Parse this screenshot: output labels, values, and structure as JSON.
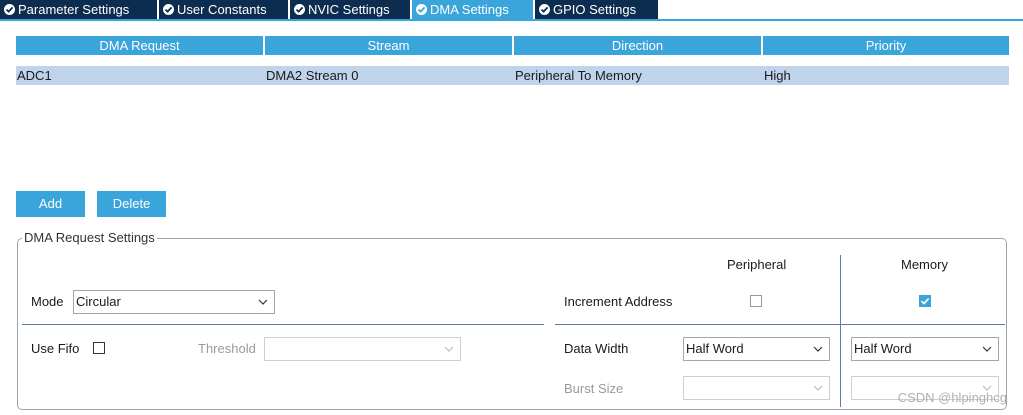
{
  "tabs": [
    {
      "label": "Parameter Settings",
      "active": false
    },
    {
      "label": "User Constants",
      "active": false
    },
    {
      "label": "NVIC Settings",
      "active": false
    },
    {
      "label": "DMA Settings",
      "active": true
    },
    {
      "label": "GPIO Settings",
      "active": false
    }
  ],
  "table": {
    "headers": [
      "DMA Request",
      "Stream",
      "Direction",
      "Priority"
    ],
    "rows": [
      [
        "ADC1",
        "DMA2 Stream 0",
        "Peripheral To Memory",
        "High"
      ]
    ]
  },
  "buttons": {
    "add": "Add",
    "delete": "Delete"
  },
  "settings": {
    "title": "DMA Request Settings",
    "peripheral_label": "Peripheral",
    "memory_label": "Memory",
    "mode_label": "Mode",
    "mode_value": "Circular",
    "increment_label": "Increment Address",
    "increment_peripheral_checked": false,
    "increment_memory_checked": true,
    "use_fifo_label": "Use Fifo",
    "use_fifo_checked": false,
    "threshold_label": "Threshold",
    "threshold_value": "",
    "data_width_label": "Data Width",
    "data_width_peripheral": "Half Word",
    "data_width_memory": "Half Word",
    "burst_size_label": "Burst Size",
    "burst_size_peripheral": "",
    "burst_size_memory": ""
  },
  "watermark": "CSDN @hlpinghcg",
  "colors": {
    "tab_dark": "#0d2d50",
    "accent": "#3aa5db",
    "row_selected": "#bfd3ea"
  }
}
